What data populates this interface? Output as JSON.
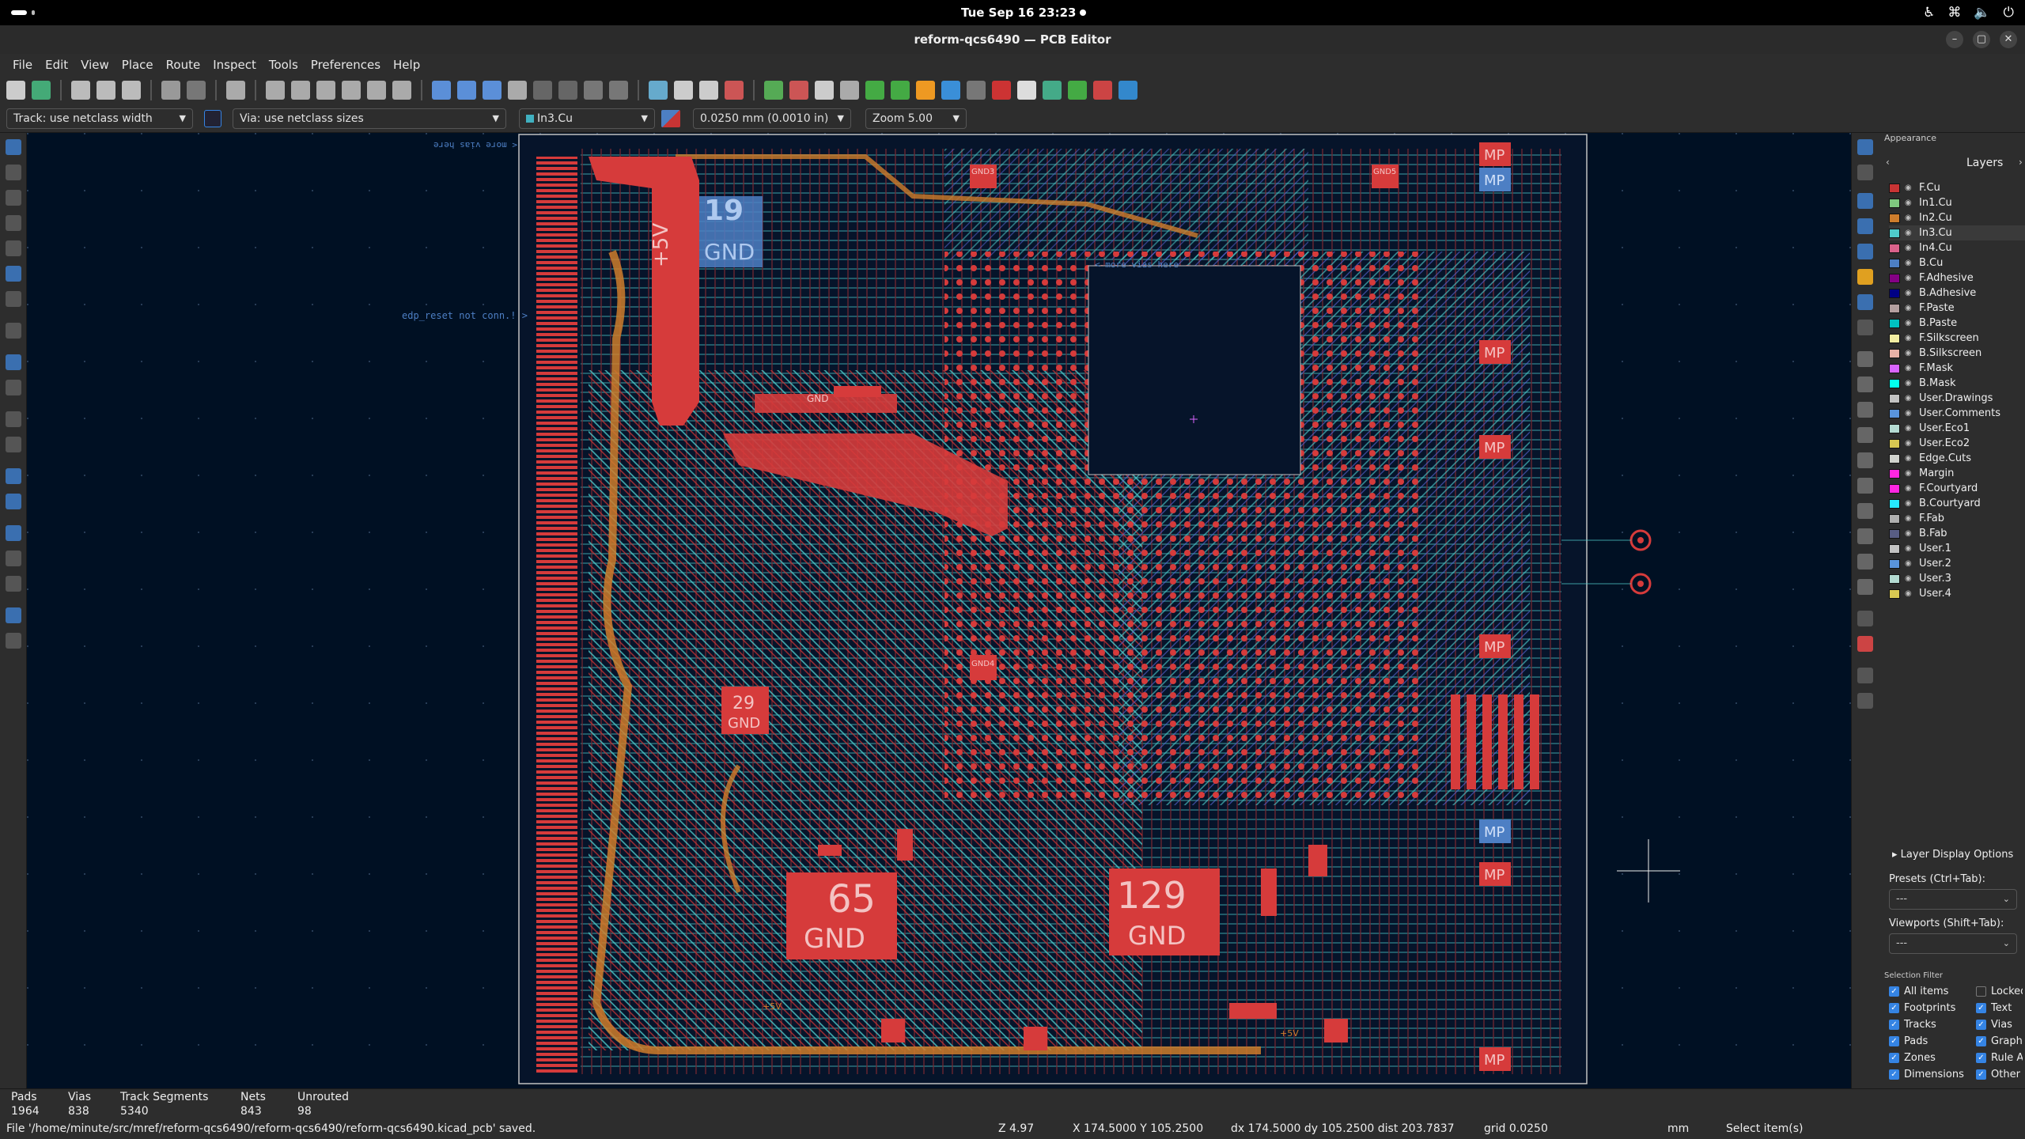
{
  "system_bar": {
    "clock": "Tue Sep 16  23:23"
  },
  "window": {
    "title": "reform-qcs6490 — PCB Editor"
  },
  "menu": [
    "File",
    "Edit",
    "View",
    "Place",
    "Route",
    "Inspect",
    "Tools",
    "Preferences",
    "Help"
  ],
  "aux_toolbar": {
    "track_width": "Track: use netclass width",
    "via_size": "Via: use netclass sizes",
    "active_layer": "In3.Cu",
    "grid": "0.0250 mm (0.0010 in)",
    "zoom": "Zoom 5.00"
  },
  "canvas": {
    "net_labels": [
      "+5V",
      "GND",
      "29",
      "GND",
      "65",
      "GND",
      "129",
      "GND",
      "GND3",
      "GND4",
      "GND5",
      "GND",
      "+5V",
      "+5V"
    ],
    "mp_labels": [
      "MP",
      "MP",
      "MP",
      "MP",
      "MP",
      "MP",
      "MP",
      "MP"
    ],
    "annotations": {
      "edp_reset": "edp_reset not conn.! >",
      "more_vias": "< more vias here",
      "more_vias_mirrored": "< more vias here"
    }
  },
  "appearance": {
    "title": "Appearance",
    "tab": "Layers",
    "layers": [
      {
        "name": "F.Cu",
        "color": "#c83434"
      },
      {
        "name": "In1.Cu",
        "color": "#7fc87f"
      },
      {
        "name": "In2.Cu",
        "color": "#ce7d2c"
      },
      {
        "name": "In3.Cu",
        "color": "#4fcbcb"
      },
      {
        "name": "In4.Cu",
        "color": "#db628b"
      },
      {
        "name": "B.Cu",
        "color": "#4d7fc4"
      },
      {
        "name": "F.Adhesive",
        "color": "#840084"
      },
      {
        "name": "B.Adhesive",
        "color": "#000084"
      },
      {
        "name": "F.Paste",
        "color": "#b4a0a0"
      },
      {
        "name": "B.Paste",
        "color": "#00c2c2"
      },
      {
        "name": "F.Silkscreen",
        "color": "#f2eda1"
      },
      {
        "name": "B.Silkscreen",
        "color": "#e8b2a7"
      },
      {
        "name": "F.Mask",
        "color": "#d864ff"
      },
      {
        "name": "B.Mask",
        "color": "#02ffee"
      },
      {
        "name": "User.Drawings",
        "color": "#c2c2c2"
      },
      {
        "name": "User.Comments",
        "color": "#5994dc"
      },
      {
        "name": "User.Eco1",
        "color": "#b4dbd2"
      },
      {
        "name": "User.Eco2",
        "color": "#d8c852"
      },
      {
        "name": "Edge.Cuts",
        "color": "#d0d2cd"
      },
      {
        "name": "Margin",
        "color": "#ff26e2"
      },
      {
        "name": "F.Courtyard",
        "color": "#ff26e2"
      },
      {
        "name": "B.Courtyard",
        "color": "#26e9ff"
      },
      {
        "name": "F.Fab",
        "color": "#afafaf"
      },
      {
        "name": "B.Fab",
        "color": "#585d84"
      },
      {
        "name": "User.1",
        "color": "#c2c2c2"
      },
      {
        "name": "User.2",
        "color": "#5994dc"
      },
      {
        "name": "User.3",
        "color": "#b4dbd2"
      },
      {
        "name": "User.4",
        "color": "#d8c852"
      }
    ],
    "layer_display_options": "Layer Display Options",
    "presets_label": "Presets (Ctrl+Tab):",
    "presets_value": "---",
    "viewports_label": "Viewports (Shift+Tab):",
    "viewports_value": "---",
    "selection_filter_title": "Selection Filter",
    "selection_filter": [
      {
        "label": "All items",
        "checked": true
      },
      {
        "label": "Locked",
        "checked": false
      },
      {
        "label": "Footprints",
        "checked": true
      },
      {
        "label": "Text",
        "checked": true
      },
      {
        "label": "Tracks",
        "checked": true
      },
      {
        "label": "Vias",
        "checked": true
      },
      {
        "label": "Pads",
        "checked": true
      },
      {
        "label": "Graphics",
        "checked": true
      },
      {
        "label": "Zones",
        "checked": true
      },
      {
        "label": "Rule Areas",
        "checked": true
      },
      {
        "label": "Dimensions",
        "checked": true
      },
      {
        "label": "Other",
        "checked": true
      }
    ]
  },
  "stats": [
    {
      "label": "Pads",
      "value": "1964"
    },
    {
      "label": "Vias",
      "value": "838"
    },
    {
      "label": "Track Segments",
      "value": "5340"
    },
    {
      "label": "Nets",
      "value": "843"
    },
    {
      "label": "Unrouted",
      "value": "98"
    }
  ],
  "statusbar": {
    "message": "File '/home/minute/src/mref/reform-qcs6490/reform-qcs6490/reform-qcs6490.kicad_pcb' saved.",
    "zoom": "Z 4.97",
    "xy": "X 174.5000  Y 105.2500",
    "delta": "dx 174.5000  dy 105.2500  dist 203.7837",
    "grid": "grid 0.0250",
    "units": "mm",
    "mode": "Select item(s)"
  }
}
